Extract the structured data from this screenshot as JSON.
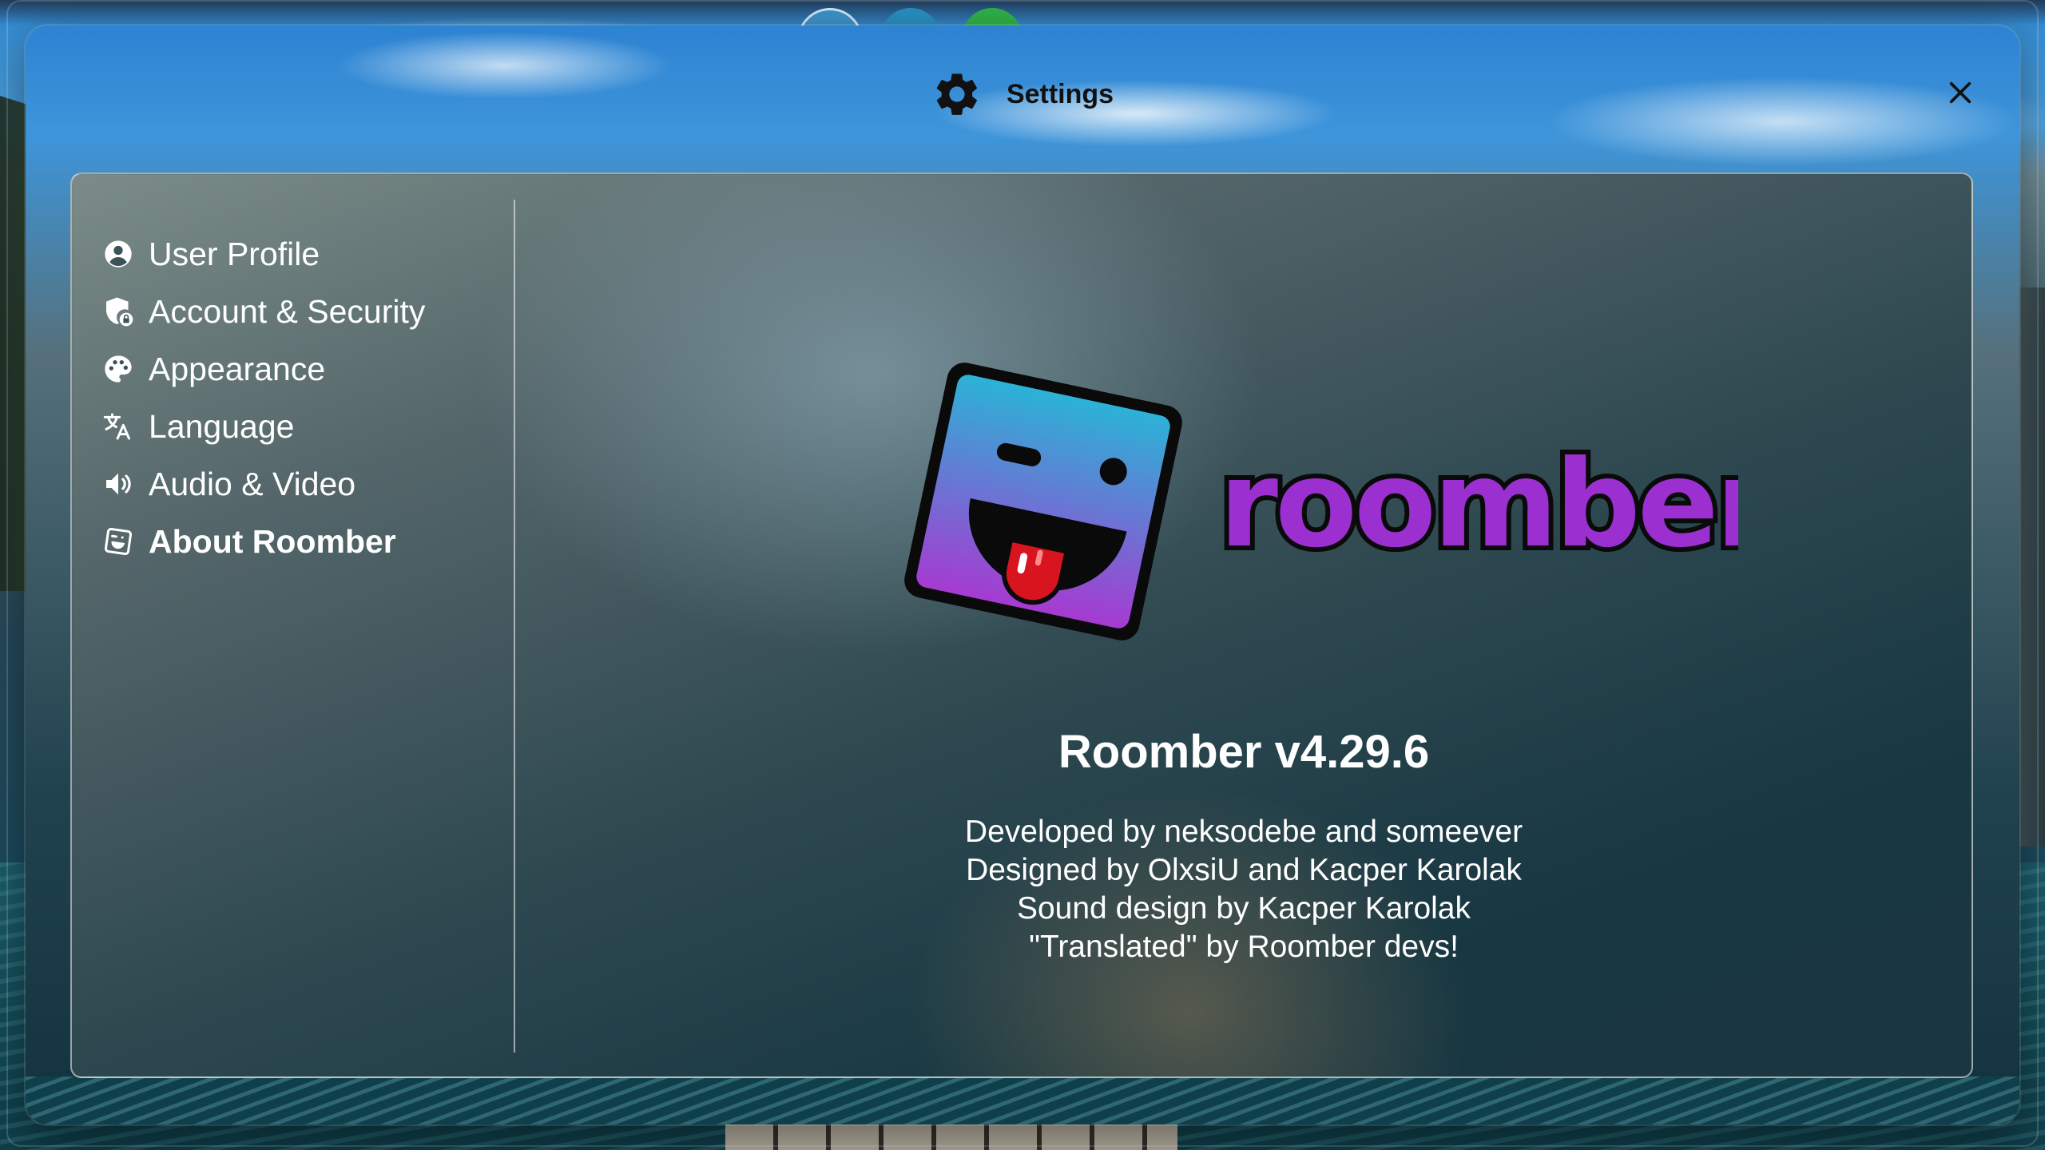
{
  "window": {
    "title": "Settings",
    "title_icon": "gear-icon",
    "close_icon": "close-icon"
  },
  "sidebar": {
    "items": [
      {
        "label": "User Profile",
        "icon": "user-circle-icon",
        "active": false
      },
      {
        "label": "Account & Security",
        "icon": "shield-lock-icon",
        "active": false
      },
      {
        "label": "Appearance",
        "icon": "palette-icon",
        "active": false
      },
      {
        "label": "Language",
        "icon": "translate-icon",
        "active": false
      },
      {
        "label": "Audio & Video",
        "icon": "speaker-icon",
        "active": false
      },
      {
        "label": "About Roomber",
        "icon": "roomber-logo-icon",
        "active": true
      }
    ]
  },
  "about": {
    "logo_wordmark": "roomber",
    "title": "Roomber v4.29.6",
    "credits": [
      "Developed by neksodebe and someever",
      "Designed by OlxsiU and Kacper Karolak",
      "Sound design by Kacper Karolak",
      "\"Translated\" by Roomber devs!"
    ]
  },
  "colors": {
    "logo_gradient_top": "#2bb3d6",
    "logo_gradient_bottom": "#a63ad1",
    "wordmark": "#9b2fd0",
    "tongue": "#d8141e"
  }
}
